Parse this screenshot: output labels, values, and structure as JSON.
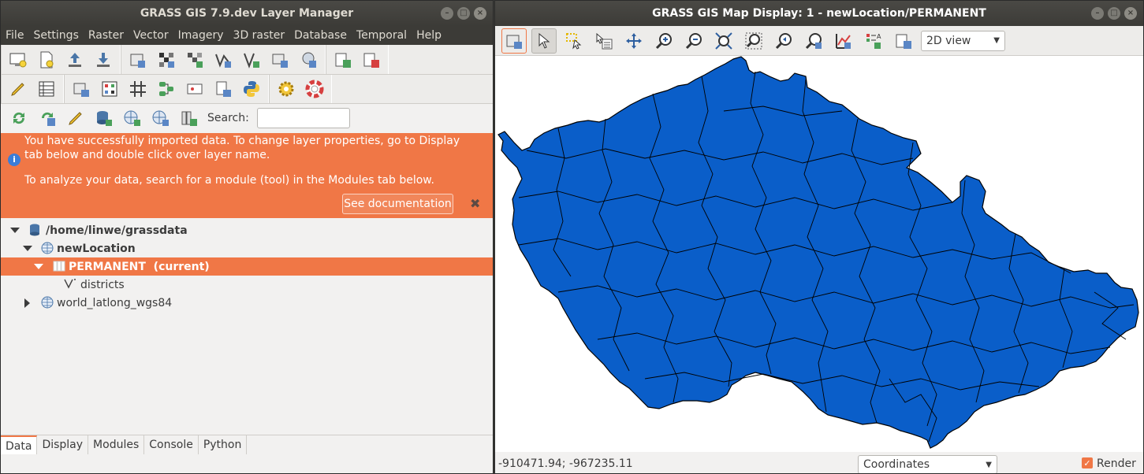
{
  "layer_manager": {
    "title": "GRASS GIS 7.9.dev Layer Manager",
    "menu": [
      "File",
      "Settings",
      "Raster",
      "Vector",
      "Imagery",
      "3D raster",
      "Database",
      "Temporal",
      "Help"
    ],
    "search_label": "Search:",
    "search_value": "",
    "info": {
      "line1": "You have successfully imported data. To change layer properties, go to Display tab below and double click over layer name.",
      "line2": "To analyze your data, search for a module (tool) in the Modules tab below.",
      "doc_button": "See documentation",
      "close": "✖"
    },
    "tree": {
      "database": "/home/linwe/grassdata",
      "location": "newLocation",
      "mapset": "PERMANENT  (current)",
      "layer": "districts",
      "other_location": "world_latlong_wgs84"
    },
    "tabs": [
      "Data",
      "Display",
      "Modules",
      "Console",
      "Python"
    ],
    "active_tab": "Data"
  },
  "map_display": {
    "title": "GRASS GIS Map Display: 1 - newLocation/PERMANENT",
    "view_mode": "2D view",
    "coordinates": "-910471.94; -967235.11",
    "status_select": "Coordinates",
    "render_label": "Render",
    "render_checked": true
  },
  "colors": {
    "accent": "#f07746",
    "map_fill": "#0a5ec9",
    "titlebar": "#3c3b37"
  }
}
